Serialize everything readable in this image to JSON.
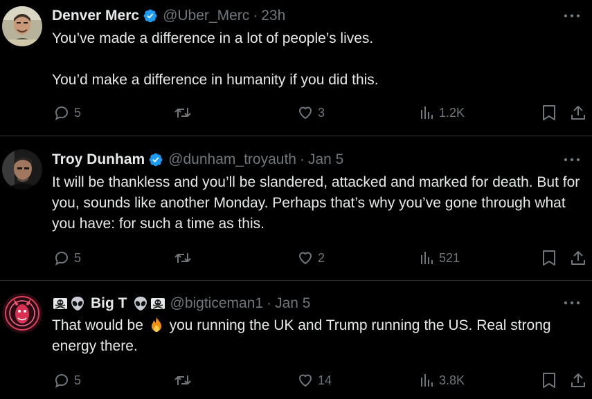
{
  "tweets": [
    {
      "name": "Denver Merc",
      "handle": "@Uber_Merc",
      "separator": "·",
      "time": "23h",
      "text": "You’ve made a difference in a lot of people’s lives.\n\nYou’d make a difference in humanity if you did this.",
      "replies": "5",
      "reposts": "",
      "likes": "3",
      "views": "1.2K"
    },
    {
      "name": "Troy Dunham",
      "handle": "@dunham_troyauth",
      "separator": "·",
      "time": "Jan 5",
      "text": "It will be thankless and you’ll be slandered, attacked and marked for death. But for you, sounds like another Monday. Perhaps that’s why you’ve gone through what you have: for such a time as this.",
      "replies": "5",
      "reposts": "",
      "likes": "2",
      "views": "521"
    },
    {
      "name": "Big T",
      "handle": "@bigticeman1",
      "separator": "·",
      "time": "Jan 5",
      "text_before": "That would be ",
      "text_after": " you running the UK and Trump running the US. Real strong energy there.",
      "replies": "5",
      "reposts": "",
      "likes": "14",
      "views": "3.8K"
    }
  ],
  "icons": {
    "verified": "verified-badge-icon",
    "reply": "reply-icon",
    "repost": "repost-icon",
    "like": "heart-icon",
    "views": "analytics-icon",
    "bookmark": "bookmark-icon",
    "share": "share-icon",
    "more": "more-icon"
  },
  "colors": {
    "background": "#000000",
    "text": "#e7e9ea",
    "muted": "#71767b",
    "verified": "#1d9bf0",
    "divider": "#2f3336"
  }
}
